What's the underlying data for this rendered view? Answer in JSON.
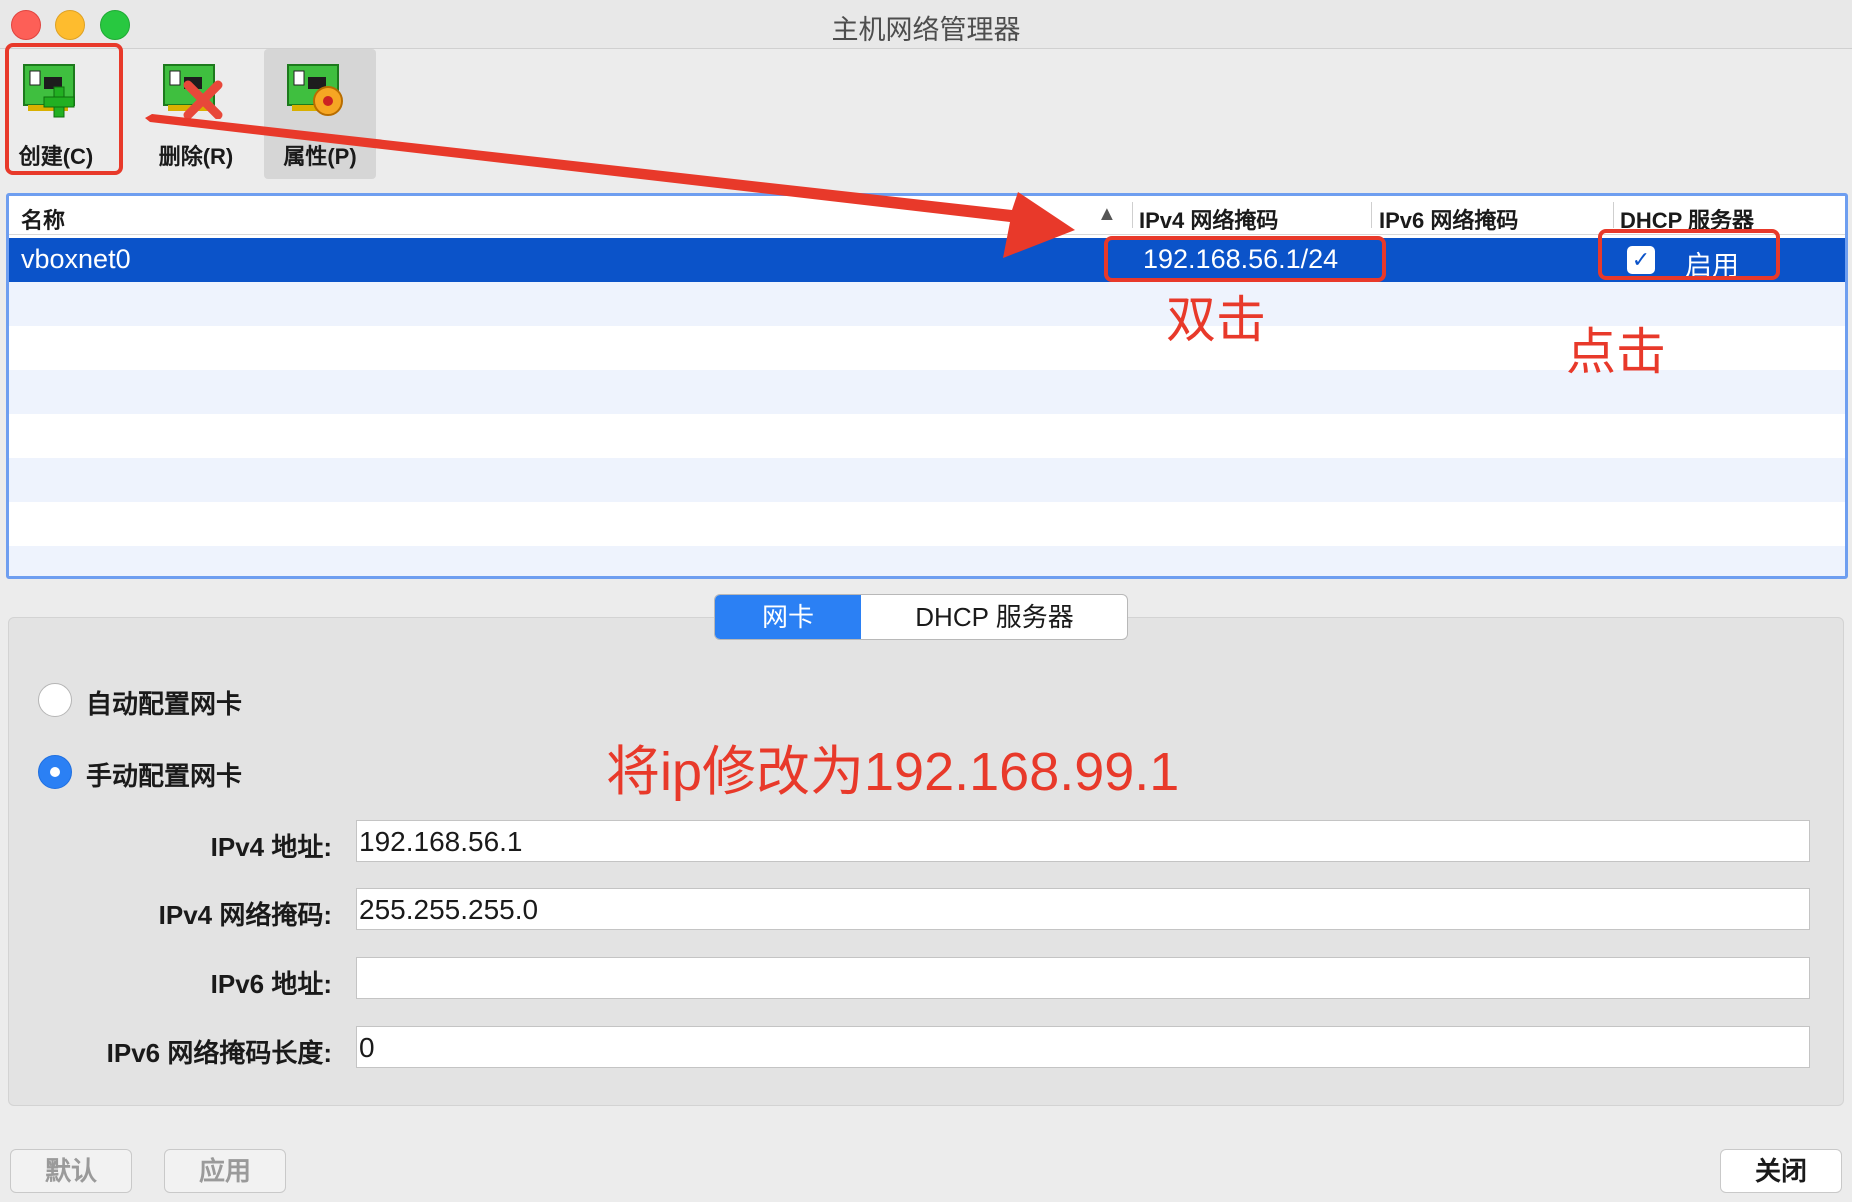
{
  "window": {
    "title": "主机网络管理器"
  },
  "toolbar": {
    "buttons": [
      {
        "label": "创建(C)",
        "icon": "network-card-add-icon"
      },
      {
        "label": "删除(R)",
        "icon": "network-card-remove-icon"
      },
      {
        "label": "属性(P)",
        "icon": "network-card-properties-icon"
      }
    ]
  },
  "table": {
    "columns": [
      "名称",
      "IPv4 网络掩码",
      "IPv6 网络掩码",
      "DHCP 服务器"
    ],
    "sort_indicator": "▲",
    "rows": [
      {
        "name": "vboxnet0",
        "ipv4": "192.168.56.1/24",
        "ipv6": "",
        "dhcp_enabled": true,
        "dhcp_label": "启用"
      }
    ]
  },
  "tabs": {
    "items": [
      "网卡",
      "DHCP 服务器"
    ],
    "selected": "网卡"
  },
  "adapter": {
    "auto_label": "自动配置网卡",
    "manual_label": "手动配置网卡",
    "mode": "manual",
    "fields": [
      {
        "label": "IPv4 地址:",
        "value": "192.168.56.1"
      },
      {
        "label": "IPv4 网络掩码:",
        "value": "255.255.255.0"
      },
      {
        "label": "IPv6 地址:",
        "value": ""
      },
      {
        "label": "IPv6 网络掩码长度:",
        "value": "0"
      }
    ]
  },
  "footer": {
    "reset_label": "默认",
    "apply_label": "应用",
    "close_label": "关闭"
  },
  "annotations": {
    "double_click": "双击",
    "click": "点击",
    "instruction": "将ip修改为192.168.99.1",
    "color": "#e8392a"
  },
  "colors": {
    "selection": "#0b53c9",
    "accent": "#2b80f4",
    "row_alt": "#eef3fd"
  }
}
